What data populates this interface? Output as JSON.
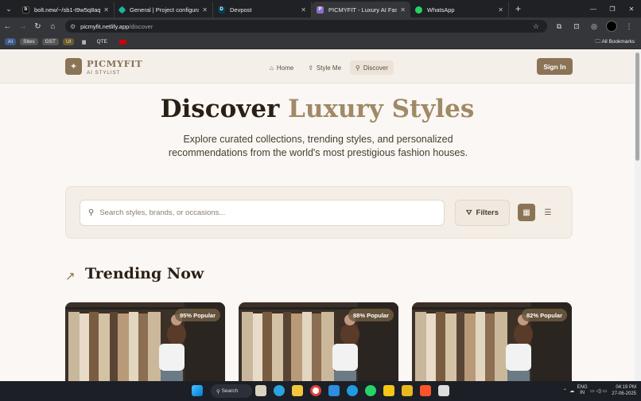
{
  "browser": {
    "tabs": [
      {
        "title": "bolt.new/~/sb1-t9w5q8aq",
        "active": false
      },
      {
        "title": "General | Project configuration",
        "active": false
      },
      {
        "title": "Devpost",
        "active": false
      },
      {
        "title": "PICMYFIT - Luxury AI Fashion St...",
        "active": true
      },
      {
        "title": "WhatsApp",
        "active": false
      }
    ],
    "url_host": "picmyfit.netlify.app",
    "url_path": "/discover",
    "bookmarks": [
      "AI",
      "Sites",
      "GST",
      "UI",
      "QTE"
    ],
    "all_bookmarks": "All Bookmarks"
  },
  "header": {
    "brand": "PICMYFIT",
    "tagline": "AI STYLIST",
    "nav": [
      {
        "label": "Home",
        "icon": "home-icon"
      },
      {
        "label": "Style Me",
        "icon": "upload-icon"
      },
      {
        "label": "Discover",
        "icon": "search-icon"
      }
    ],
    "signin": "Sign In"
  },
  "hero": {
    "title_part1": "Discover",
    "title_part2": "Luxury Styles",
    "description": "Explore curated collections, trending styles, and personalized recommendations from the world's most prestigious fashion houses."
  },
  "search": {
    "placeholder": "Search styles, brands, or occasions...",
    "filters_label": "Filters"
  },
  "trending": {
    "title": "Trending Now",
    "cards": [
      {
        "badge": "95% Popular"
      },
      {
        "badge": "88% Popular"
      },
      {
        "badge": "82% Popular"
      }
    ]
  },
  "taskbar": {
    "search_label": "Search",
    "lang": "ENG",
    "region": "IN",
    "time": "04:19 PM",
    "date": "27-06-2025"
  }
}
